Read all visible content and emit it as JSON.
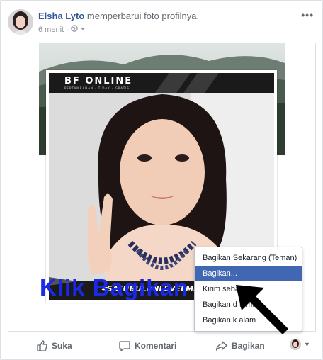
{
  "post": {
    "author_name": "Elsha Lyto",
    "action_text": "memperbarui foto profilnya.",
    "timestamp": "6 menit",
    "separator": "·",
    "privacy_icon": "globe-icon",
    "more_icon": "more-horizontal-icon"
  },
  "photo": {
    "brand_text": "BF ONLINE",
    "brand_sub": "PERTAMBAHAN · TIDAK · GRATIS",
    "hashtag": "#SATUBULANLEVELMENTOK"
  },
  "overlay": {
    "caption": "Klik Bagikan"
  },
  "share_menu": {
    "items": [
      {
        "label": "Bagikan Sekarang (Teman)",
        "active": false
      },
      {
        "label": "Bagikan...",
        "active": true
      },
      {
        "label": "Kirim seba",
        "active": false
      },
      {
        "label": "Bagikan d       teman",
        "active": false
      },
      {
        "label": "Bagikan k      alam",
        "active": false
      }
    ]
  },
  "actions": {
    "like": "Suka",
    "comment": "Komentari",
    "share": "Bagikan"
  },
  "colors": {
    "link": "#365899",
    "menu_highlight": "#4267b2",
    "caption": "#1a28e8"
  }
}
